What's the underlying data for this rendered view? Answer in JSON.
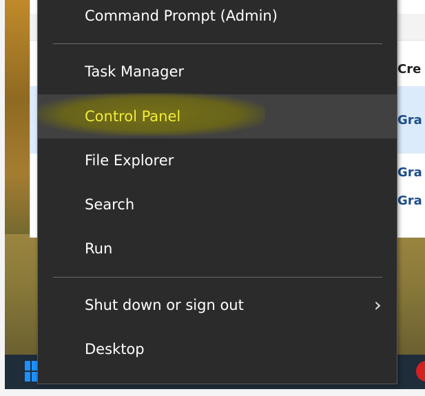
{
  "menu": {
    "items": [
      {
        "label": "Command Prompt (Admin)",
        "state": "normal"
      },
      {
        "label": "Task Manager",
        "state": "normal"
      },
      {
        "label": "Control Panel",
        "state": "highlighted"
      },
      {
        "label": "File Explorer",
        "state": "normal"
      },
      {
        "label": "Search",
        "state": "normal"
      },
      {
        "label": "Run",
        "state": "normal"
      },
      {
        "label": "Shut down or sign out",
        "state": "normal",
        "submenu_icon": "chevron-right-icon"
      },
      {
        "label": "Desktop",
        "state": "normal"
      }
    ]
  },
  "background_window": {
    "column_header": "Cre",
    "cells": [
      "Gra",
      "Gra",
      "Gra"
    ]
  },
  "taskbar": {
    "start_icon": "windows-logo-icon"
  },
  "colors": {
    "menu_bg": "#2b2b2b",
    "hover_bg": "#414141",
    "highlight_text": "#f2ec3a",
    "text": "#ffffff",
    "separator": "#6a6a6a"
  }
}
